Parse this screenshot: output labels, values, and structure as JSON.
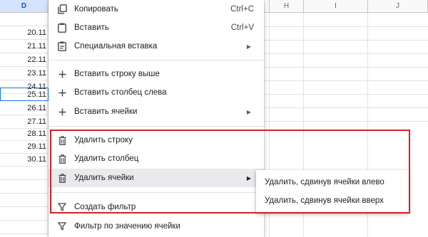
{
  "columns": {
    "d": "D",
    "h": "H",
    "i": "I",
    "j": "J"
  },
  "rows": [
    "20.11",
    "21.11",
    "22.11",
    "23.11",
    "24.11",
    "25.11",
    "26.11",
    "27.11",
    "28.11",
    "29.11",
    "30.11"
  ],
  "selected_row_index": 5,
  "menu": {
    "copy": {
      "label": "Копировать",
      "shortcut": "Ctrl+C",
      "icon": "copy-icon"
    },
    "paste": {
      "label": "Вставить",
      "shortcut": "Ctrl+V",
      "icon": "paste-icon"
    },
    "paste_special": {
      "label": "Специальная вставка",
      "icon": "paste-special-icon"
    },
    "insert_row_above": {
      "label": "Вставить строку выше",
      "icon": "plus-icon"
    },
    "insert_column_left": {
      "label": "Вставить столбец слева",
      "icon": "plus-icon"
    },
    "insert_cells": {
      "label": "Вставить ячейки",
      "icon": "plus-icon"
    },
    "delete_row": {
      "label": "Удалить строку",
      "icon": "trash-icon"
    },
    "delete_column": {
      "label": "Удалить столбец",
      "icon": "trash-icon"
    },
    "delete_cells": {
      "label": "Удалить ячейки",
      "icon": "trash-icon"
    },
    "create_filter": {
      "label": "Создать фильтр",
      "icon": "filter-icon"
    },
    "filter_by_value": {
      "label": "Фильтр по значению ячейки",
      "icon": "filter-icon"
    }
  },
  "submenu": {
    "shift_left": "Удалить, сдвинув ячейки влево",
    "shift_up": "Удалить, сдвинув ячейки вверх"
  },
  "colors": {
    "highlight": "#d6202a",
    "selection": "#1a73e8",
    "hover": "#e8eaed"
  }
}
